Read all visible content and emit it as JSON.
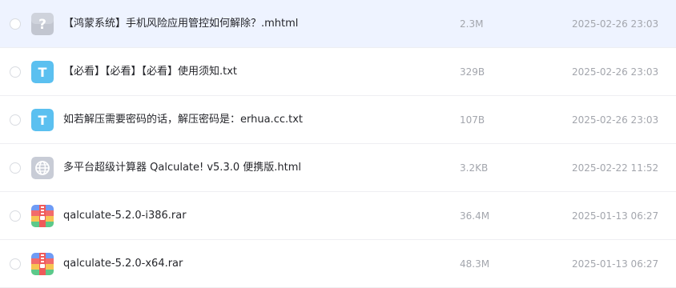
{
  "files": [
    {
      "name": "【鸿蒙系统】手机风险应用管控如何解除？.mhtml",
      "size": "2.3M",
      "date": "2025-02-26 23:03",
      "icon": "unknown-file-icon",
      "selected": true
    },
    {
      "name": "【必看】【必看】【必看】使用须知.txt",
      "size": "329B",
      "date": "2025-02-26 23:03",
      "icon": "text-file-icon",
      "icon_letter": "T"
    },
    {
      "name": "如若解压需要密码的话，解压密码是：erhua.cc.txt",
      "size": "107B",
      "date": "2025-02-26 23:03",
      "icon": "text-file-icon",
      "icon_letter": "T"
    },
    {
      "name": "多平台超级计算器 Qalculate! v5.3.0 便携版.html",
      "size": "3.2KB",
      "date": "2025-02-22 11:52",
      "icon": "web-file-icon"
    },
    {
      "name": "qalculate-5.2.0-i386.rar",
      "size": "36.4M",
      "date": "2025-01-13 06:27",
      "icon": "archive-file-icon"
    },
    {
      "name": "qalculate-5.2.0-x64.rar",
      "size": "48.3M",
      "date": "2025-01-13 06:27",
      "icon": "archive-file-icon"
    }
  ],
  "colors": {
    "selected_row_bg": "#eef3ff",
    "text_icon_bg": "#5bc0f0",
    "unknown_icon_bg": "#c2c6d0",
    "web_icon_bg": "#c8ccd6"
  }
}
